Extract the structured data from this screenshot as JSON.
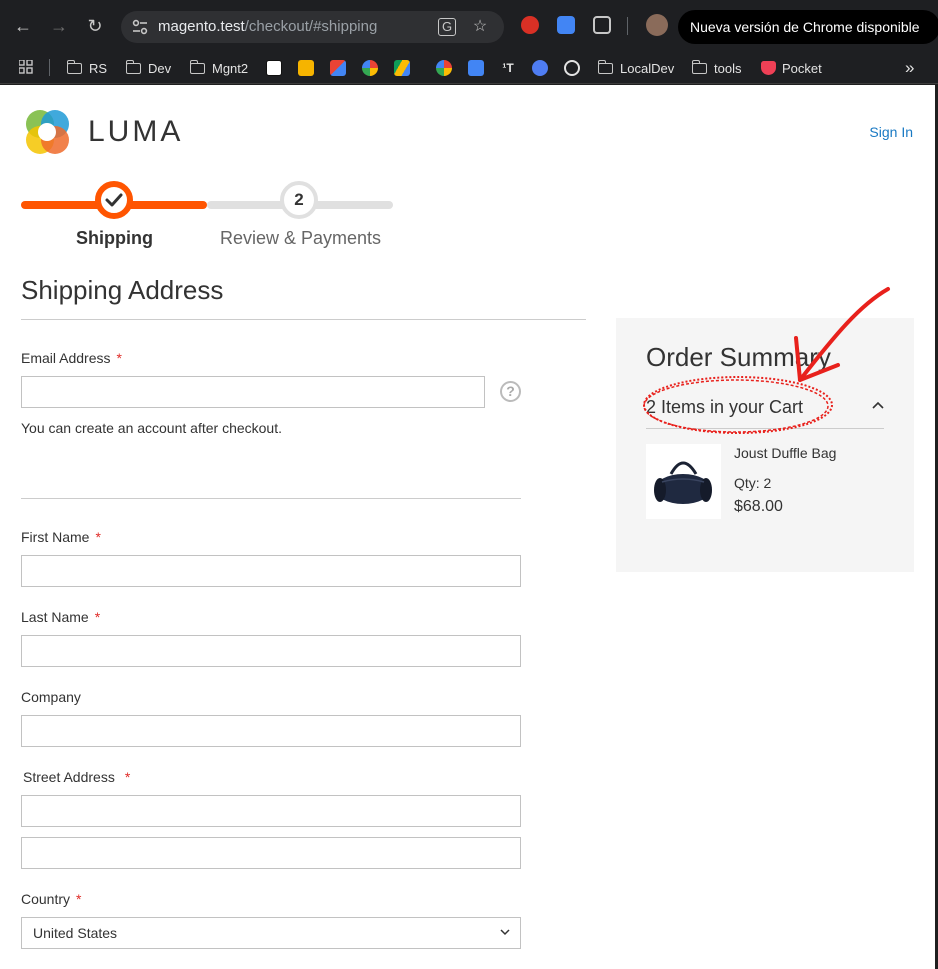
{
  "browser": {
    "url_host": "magento.test",
    "url_path": "/checkout/#shipping",
    "update_label": "Nueva versión de Chrome disponible",
    "bookmarks": [
      "RS",
      "Dev",
      "Mgnt2",
      "LocalDev",
      "tools",
      "Pocket"
    ],
    "overflow_label": "»"
  },
  "header": {
    "logo_text": "LUMA",
    "signin": "Sign In"
  },
  "progress": {
    "step1_label": "Shipping",
    "step2_number": "2",
    "step2_label": "Review & Payments"
  },
  "shipping": {
    "title": "Shipping Address",
    "email_label": "Email Address",
    "help_icon": "?",
    "email_note": "You can create an account after checkout.",
    "first_name_label": "First Name",
    "last_name_label": "Last Name",
    "company_label": "Company",
    "street_label": "Street Address",
    "country_label": "Country",
    "country_value": "United States",
    "required_mark": "*"
  },
  "summary": {
    "title": "Order Summary",
    "cart_count": "2 Items in your Cart",
    "item_name": "Joust Duffle Bag",
    "item_qty": "Qty: 2",
    "item_price": "$68.00"
  },
  "colors": {
    "accent": "#ff5501",
    "link": "#1979c3",
    "required": "#e02b27",
    "annotation": "#e8211c"
  }
}
